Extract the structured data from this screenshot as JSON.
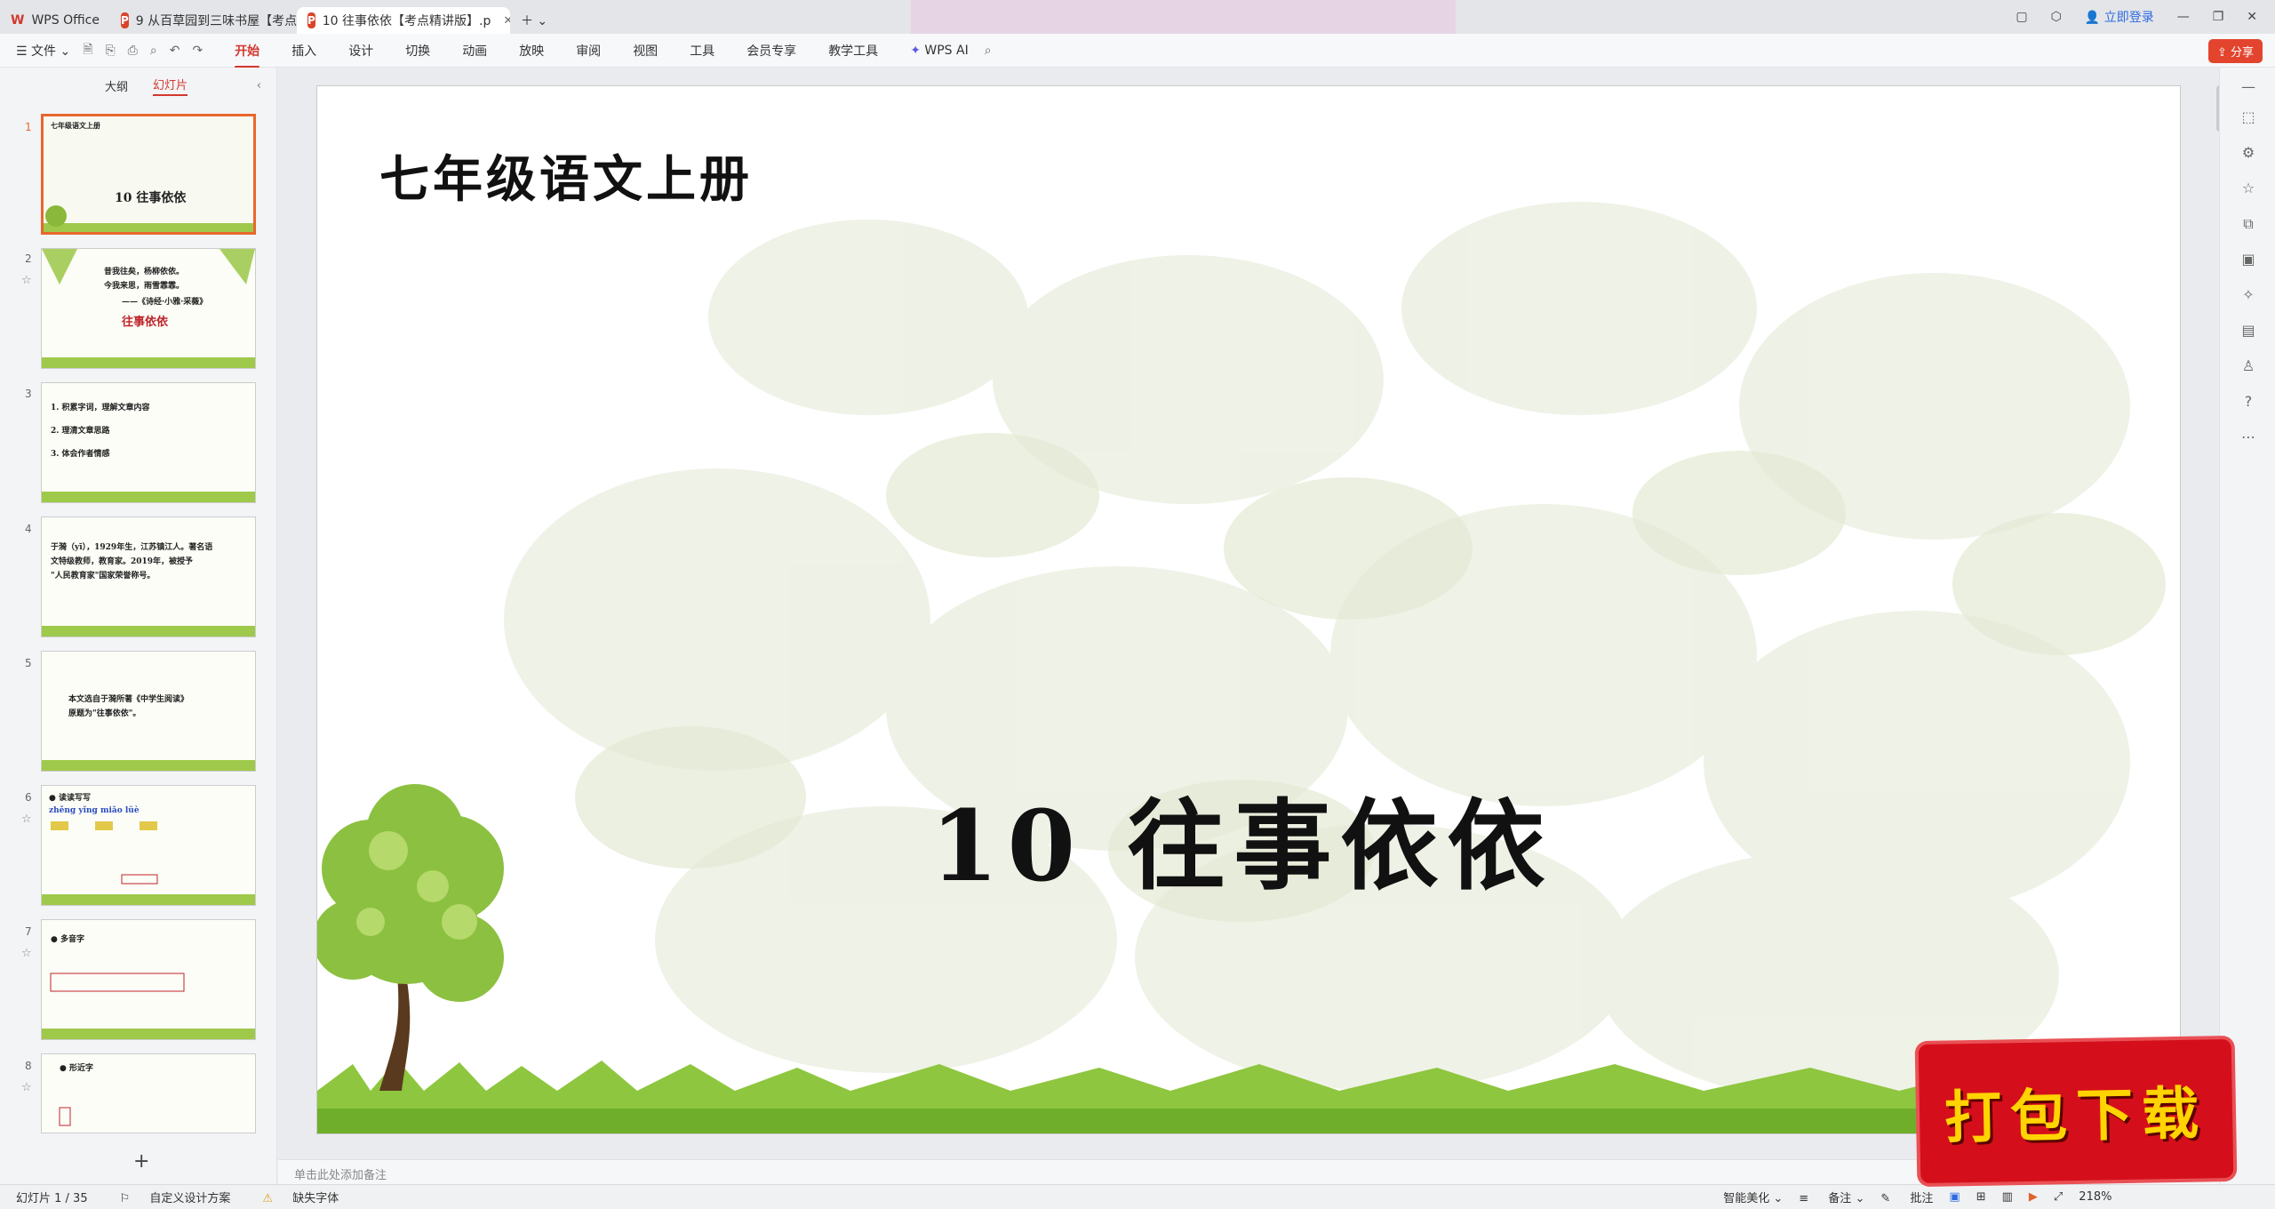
{
  "tabs": [
    {
      "label": "WPS Office"
    },
    {
      "label": "9 从百草园到三味书屋【考点精讲"
    },
    {
      "label": "10 往事依依【考点精讲版】.p"
    }
  ],
  "topright": {
    "login": "立即登录"
  },
  "ribbon": {
    "file": "文件",
    "menus": [
      "开始",
      "插入",
      "设计",
      "切换",
      "动画",
      "放映",
      "审阅",
      "视图",
      "工具",
      "会员专享",
      "教学工具"
    ],
    "ai": "WPS AI",
    "share": "分享"
  },
  "panel": {
    "tab_outline": "大纲",
    "tab_slides": "幻灯片",
    "add": "+"
  },
  "thumbs": [
    {
      "num": "1",
      "title": "七年级语文上册",
      "main": "10 往事依依"
    },
    {
      "num": "2",
      "lines": [
        "昔我往矣，杨柳依依。",
        "今我来思，雨雪霏霏。",
        "——《诗经·小雅·采薇》",
        "往事依依"
      ]
    },
    {
      "num": "3",
      "lines": [
        "1. 积累字词，理解文章内容",
        "2. 理清文章思路",
        "3. 体会作者情感"
      ]
    },
    {
      "num": "4",
      "lines": [
        "于漪（yī），1929年生，江苏镇江人。著名语",
        "文特级教师，教育家。2019年，被授予",
        "\"人民教育家\"国家荣誉称号。"
      ]
    },
    {
      "num": "5",
      "lines": [
        "本文选自于漪所著《中学生阅读》",
        "原题为\"往事依依\"。"
      ]
    },
    {
      "num": "6",
      "lines": [
        "● 读读写写",
        "zhěng yǐng   miǎo   lüè"
      ]
    },
    {
      "num": "7",
      "lines": [
        "● 多音字"
      ]
    },
    {
      "num": "8",
      "lines": [
        "● 形近字"
      ]
    }
  ],
  "slide": {
    "header": "七年级语文上册",
    "title": "10  往事依依"
  },
  "notes_placeholder": "单击此处添加备注",
  "status": {
    "slide_count": "幻灯片 1 / 35",
    "custom_design": "自定义设计方案",
    "missing_font": "缺失字体",
    "beautify": "智能美化",
    "notes": "备注",
    "comments": "批注",
    "zoom": "218%"
  },
  "watermark": "打包下载",
  "colors": {
    "accent": "#d3382e",
    "tab_bg": "#e3e5e9",
    "selected_thumb": "#e8672d"
  }
}
